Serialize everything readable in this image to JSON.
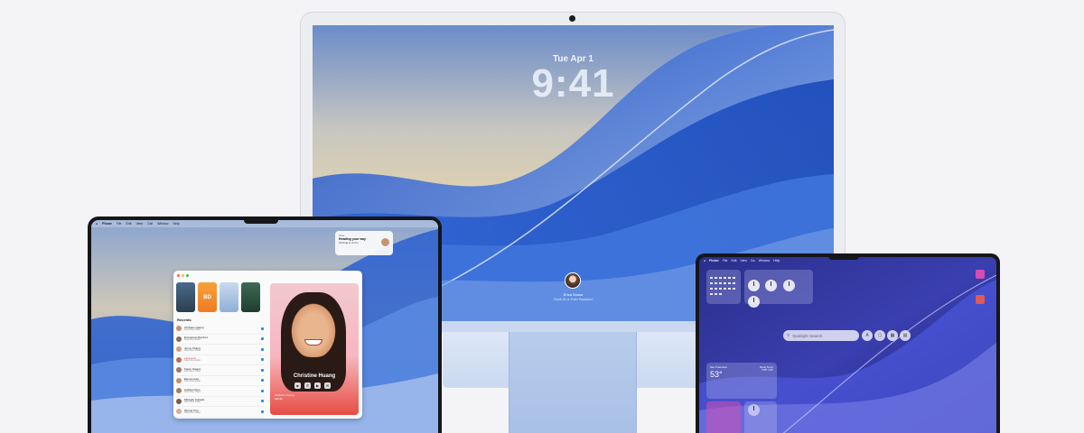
{
  "imac": {
    "date": "Tue Apr 1",
    "time": "9:41",
    "user_name": "Erica Sousa",
    "hint": "Touch ID or Enter Password"
  },
  "macbook_pro": {
    "menubar": [
      "Phone",
      "File",
      "Edit",
      "View",
      "Call",
      "Window",
      "Help"
    ],
    "notification": {
      "app": "Uber",
      "title": "Heading your way",
      "body": "Arriving in 4 min"
    },
    "facetime": {
      "tiles": [
        {
          "label": "",
          "text": ""
        },
        {
          "label": "",
          "text": "BD"
        },
        {
          "label": "",
          "text": ""
        },
        {
          "label": "",
          "text": ""
        }
      ],
      "recents_heading": "Recents",
      "recents": [
        {
          "name": "Christine Huang",
          "sub": "FaceTime Video",
          "date": "",
          "missed": false
        },
        {
          "name": "Emmanuel Ramirez",
          "sub": "FaceTime Audio",
          "date": "",
          "missed": false
        },
        {
          "name": "Jenny Chang",
          "sub": "FaceTime Video",
          "date": "",
          "missed": false
        },
        {
          "name": "Lara Lieb",
          "sub": "FaceTime Audio",
          "date": "",
          "missed": true
        },
        {
          "name": "Karen Gleave",
          "sub": "FaceTime Video",
          "date": "",
          "missed": false
        },
        {
          "name": "Elena Lanot",
          "sub": "FaceTime Audio",
          "date": "",
          "missed": false
        },
        {
          "name": "Andrea Chon",
          "sub": "FaceTime Video",
          "date": "",
          "missed": false
        },
        {
          "name": "Michelle Kurtade",
          "sub": "FaceTime Audio",
          "date": "",
          "missed": false
        },
        {
          "name": "Ifeoma Chu",
          "sub": "FaceTime Video",
          "date": "",
          "missed": false
        }
      ],
      "caller_name": "Christine Huang",
      "call_info": [
        "Christine Huang",
        "Mobile"
      ]
    }
  },
  "macbook_air": {
    "menubar": [
      "Finder",
      "File",
      "Edit",
      "View",
      "Go",
      "Window",
      "Help"
    ],
    "spotlight_placeholder": "Spotlight Search",
    "weather": {
      "city": "San Francisco",
      "temp": "53°",
      "condition": "Mostly Sunny",
      "range": "H:65° L:52°"
    },
    "side_labels": [
      "",
      ""
    ]
  },
  "colors": {
    "imac_bezel": "#ecedf1",
    "imac_stand": "#b8cdec",
    "wallpaper_blue": "#3b6fd0",
    "air_wallpaper": "#2a2f8c",
    "facetime_green": "#34c759"
  }
}
